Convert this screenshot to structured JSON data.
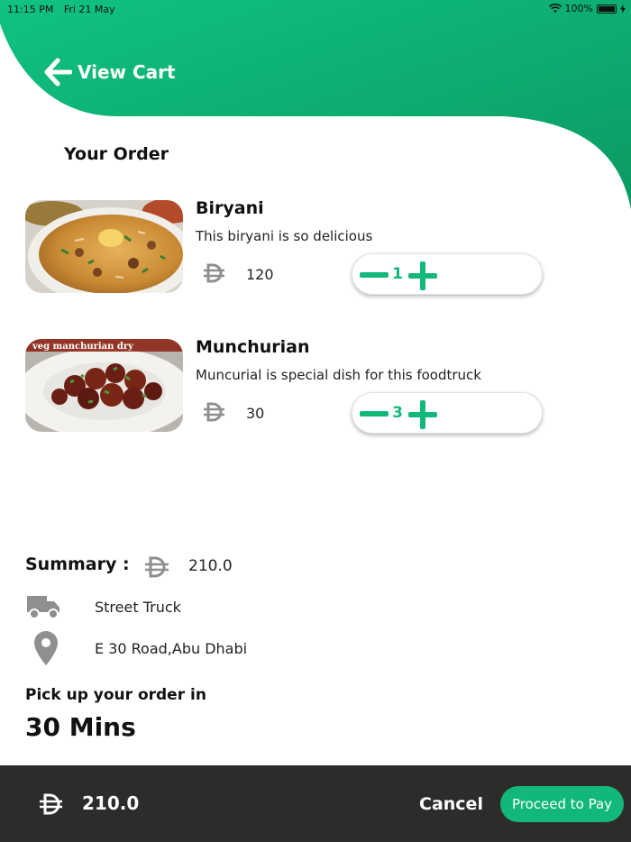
{
  "status_bar": {
    "time": "11:15 PM",
    "date": "Fri 21 May",
    "battery": "100%"
  },
  "header": {
    "title": "View Cart",
    "back_icon": "arrow-left-icon",
    "color_start": "#10c281",
    "color_end": "#0b9a63"
  },
  "order": {
    "section_title": "Your Order",
    "items": [
      {
        "name": "Biryani",
        "description": "This biryani is so delicious",
        "currency_icon": "dirham-icon",
        "price": "120",
        "quantity": "1",
        "image": "biryani-photo"
      },
      {
        "name": "Munchurian",
        "description": "Muncurial is special dish for this foodtruck",
        "currency_icon": "dirham-icon",
        "price": "30",
        "quantity": "3",
        "image": "manchurian-photo",
        "image_caption": "veg manchurian dry"
      }
    ]
  },
  "summary": {
    "label": "Summary :",
    "currency_icon": "dirham-icon",
    "total": "210.0"
  },
  "vendor": {
    "name": "Street Truck",
    "icon": "truck-icon"
  },
  "location": {
    "address": "E 30 Road,Abu Dhabi",
    "icon": "location-pin-icon"
  },
  "pickup": {
    "label": "Pick up your order in",
    "time": "30 Mins"
  },
  "footer": {
    "total": "210.0",
    "cancel_label": "Cancel",
    "pay_label": "Proceed to Pay"
  },
  "colors": {
    "accent": "#12b87a",
    "footer_bg": "#2d2c2b",
    "icon_gray": "#8f8f8f"
  }
}
